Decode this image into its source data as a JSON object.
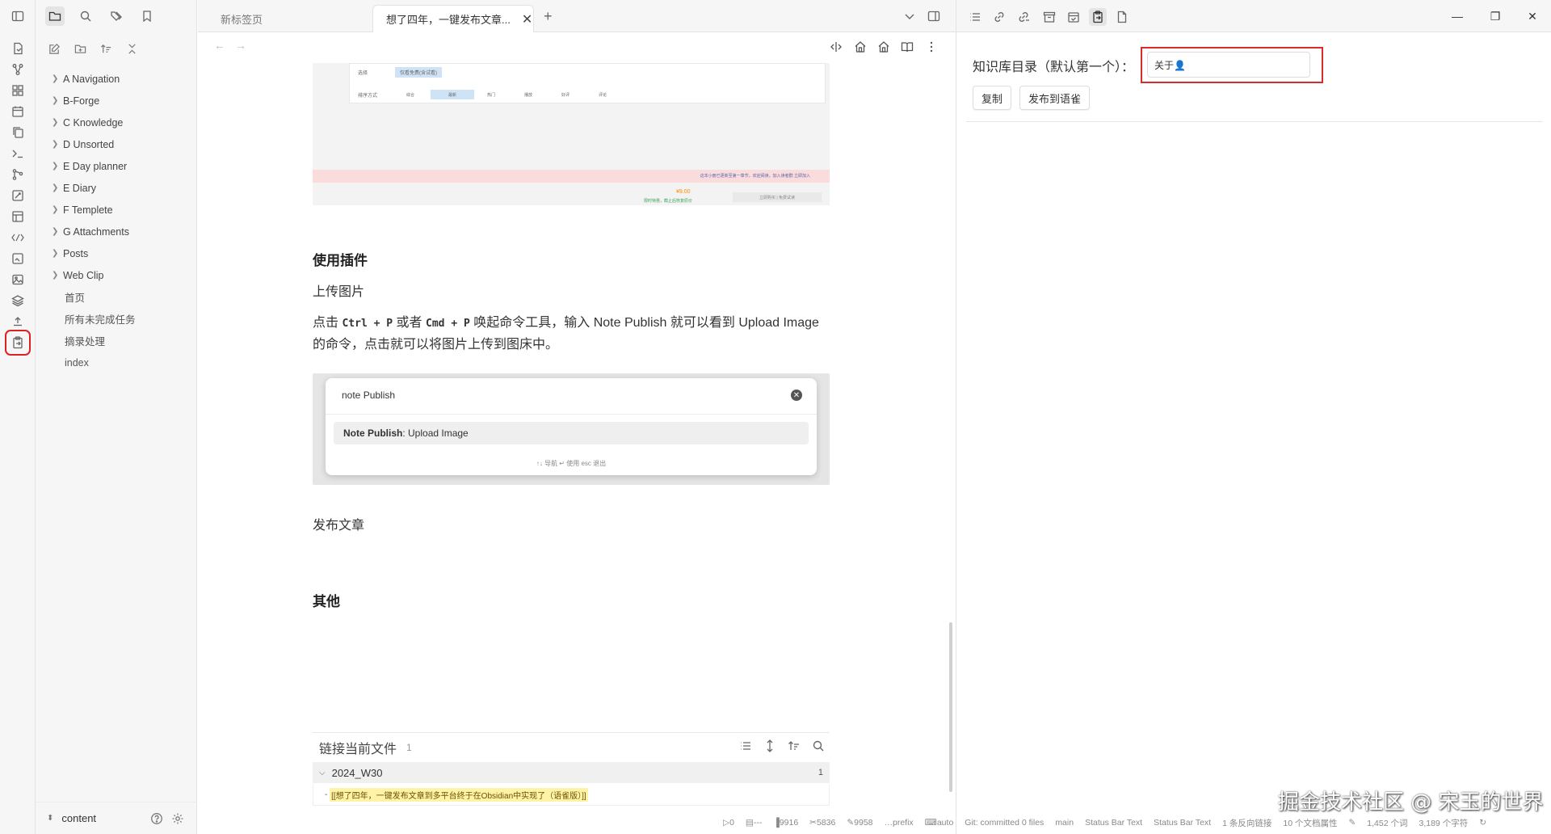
{
  "tabs": [
    {
      "label": "新标签页"
    },
    {
      "label": "想了四年，一键发布文章..."
    }
  ],
  "sidebar": {
    "items": [
      {
        "label": "A Navigation"
      },
      {
        "label": "B-Forge"
      },
      {
        "label": "C Knowledge"
      },
      {
        "label": "D Unsorted"
      },
      {
        "label": "E Day planner"
      },
      {
        "label": "E Diary"
      },
      {
        "label": "F Templete"
      },
      {
        "label": "G Attachments"
      },
      {
        "label": "Posts"
      },
      {
        "label": "Web Clip"
      }
    ],
    "files": [
      {
        "label": "首页"
      },
      {
        "label": "所有未完成任务"
      },
      {
        "label": "摘录处理"
      },
      {
        "label": "index"
      }
    ],
    "vault": "content"
  },
  "doc": {
    "img1": {
      "label_row1": "选择",
      "label_row2": "排序方式",
      "chip": "仅看免费(含试看)",
      "segments": [
        "综合",
        "最新",
        "热门",
        "播放",
        "好评",
        "评论"
      ],
      "pink_text": "这本小册已更新至第一章节，欢迎阅读，加入读者群 立即加入",
      "price": "¥9.00",
      "green": "限时特惠，截止后恢复原价",
      "grey": "立即购买 | 免费试读"
    },
    "h_plugin": "使用插件",
    "p_upload": "上传图片",
    "p_desc_1": "点击",
    "kbd1": "Ctrl + P",
    "p_desc_2": "或者",
    "kbd2": "Cmd + P",
    "p_desc_3": "唤起命令工具，输入 Note Publish 就可以看到 Upload Image 的命令，点击就可以将图片上传到图床中。",
    "img2": {
      "query": "note Publish",
      "result_bold": "Note Publish",
      "result_rest": ": Upload Image",
      "hint": "↑↓ 导航    ↵ 使用    esc 退出"
    },
    "p_publish": "发布文章",
    "h_other": "其他"
  },
  "backlinks": {
    "title": "链接当前文件",
    "count": "1",
    "group": "2024_W30",
    "group_count": "1",
    "ref": "[[想了四年，一键发布文章到多平台终于在Obsidian中实现了（语雀版）]]"
  },
  "rightpanel": {
    "label": "知识库目录（默认第一个）：",
    "input_value": "关于👤",
    "copy_button": "复制",
    "publish_button": "发布到语雀"
  },
  "statusbar": {
    "items": [
      "0",
      "---",
      "9916",
      "5836",
      "9958",
      "prefix",
      "auto",
      "Git: committed 0 files",
      "main",
      "Status Bar Text",
      "Status Bar Text",
      "1 条反向链接",
      "10 个文档属性",
      "1,452 个词",
      "3,189 个字符"
    ]
  },
  "watermark": "掘金技术社区 @ 宋玉的世界",
  "colors": {
    "highlight_red": "#d92b2b",
    "accent": "#7b5fd6",
    "yellow_mark": "#fff3a8"
  }
}
